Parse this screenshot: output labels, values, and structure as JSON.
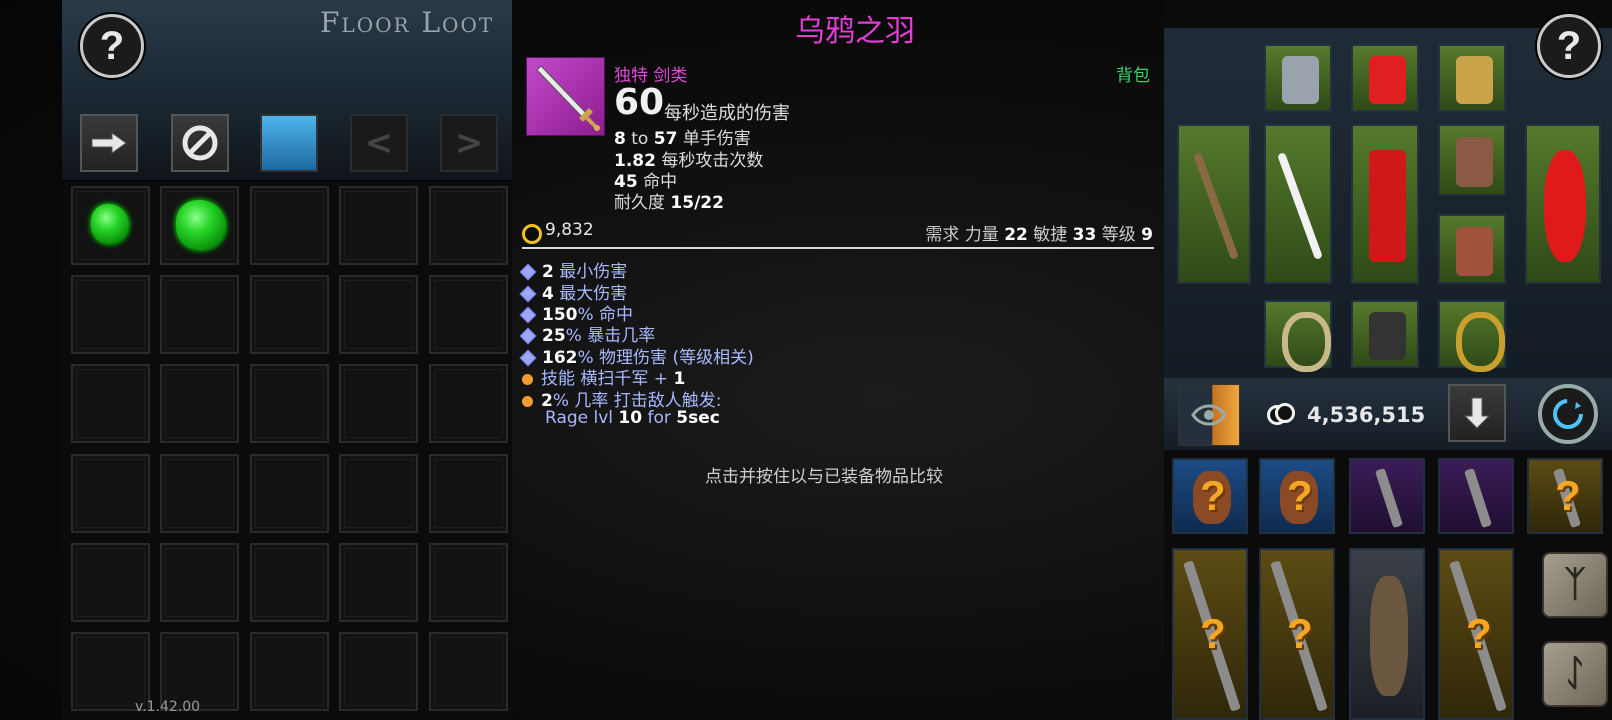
{
  "left_panel": {
    "title": "Floor Loot",
    "help_label": "?",
    "version": "v.1.42.00",
    "toolbar": {
      "transfer_icon": "arrow-right-icon",
      "block_icon": "no-entry-icon",
      "prev_label": "<",
      "next_label": ">"
    },
    "loot_items": [
      {
        "slot": 1,
        "name": "green-gem"
      },
      {
        "slot": 2,
        "name": "green-gem"
      }
    ]
  },
  "tooltip": {
    "item_name": "乌鸦之羽",
    "item_type": "独特 剑类",
    "location": "背包",
    "dps_value": "60",
    "dps_label": "每秒造成的伤害",
    "damage_min": "8",
    "damage_to": "to",
    "damage_max": "57",
    "damage_label": "单手伤害",
    "aps_value": "1.82",
    "aps_label": "每秒攻击次数",
    "hit_value": "45",
    "hit_label": "命中",
    "durability_label": "耐久度",
    "durability_value": "15/22",
    "gold_value": "9,832",
    "requirements": {
      "label": "需求",
      "str_label": "力量",
      "str_value": "22",
      "dex_label": "敏捷",
      "dex_value": "33",
      "level_label": "等级",
      "level_value": "9"
    },
    "affixes": [
      {
        "value": "2",
        "text": "最小伤害",
        "type": "magic"
      },
      {
        "value": "4",
        "text": "最大伤害",
        "type": "magic"
      },
      {
        "value": "150",
        "text": "% 命中",
        "type": "magic"
      },
      {
        "value": "25",
        "text": "% 暴击几率",
        "type": "magic"
      },
      {
        "value": "162",
        "text": "% 物理伤害 (等级相关)",
        "type": "magic"
      },
      {
        "prefix": "技能 横扫千军 + ",
        "value": "1",
        "type": "unique"
      },
      {
        "value": "2",
        "text": "% 几率 打击敌人触发:",
        "type": "unique"
      }
    ],
    "proc_text_a": "Rage lvl ",
    "proc_level": "10",
    "proc_text_b": " for ",
    "proc_duration": "5sec",
    "compare_hint": "点击并按住以与已装备物品比较"
  },
  "right_panel": {
    "help_label": "?",
    "total_gold": "4,536,515",
    "equipment_icons": [
      "amulet-icon",
      "santa-hat-icon",
      "compass-amulet-icon",
      "bow-icon",
      "candy-cane-icon",
      "santa-suit-icon",
      "gloves-icon",
      "sack-icon",
      "boots-icon",
      "ring-icon",
      "potion-icon",
      "gold-ring-icon"
    ],
    "backpack_icons": [
      "unknown-flask-icon",
      "unknown-helmet-icon",
      "sword-icon",
      "mace-icon",
      "unknown-hammer-icon",
      "unknown-crossbow-icon",
      "unknown-crossbow-icon",
      "armor-icon",
      "unknown-sword-icon"
    ],
    "runes": [
      "ᛉ",
      "ᛇ"
    ],
    "question_mark": "?"
  },
  "colors": {
    "unique_name": "#e23ed6",
    "bag_label": "#39d46a",
    "magic_affix": "#a8b8ff",
    "gold": "#f2c21a"
  }
}
